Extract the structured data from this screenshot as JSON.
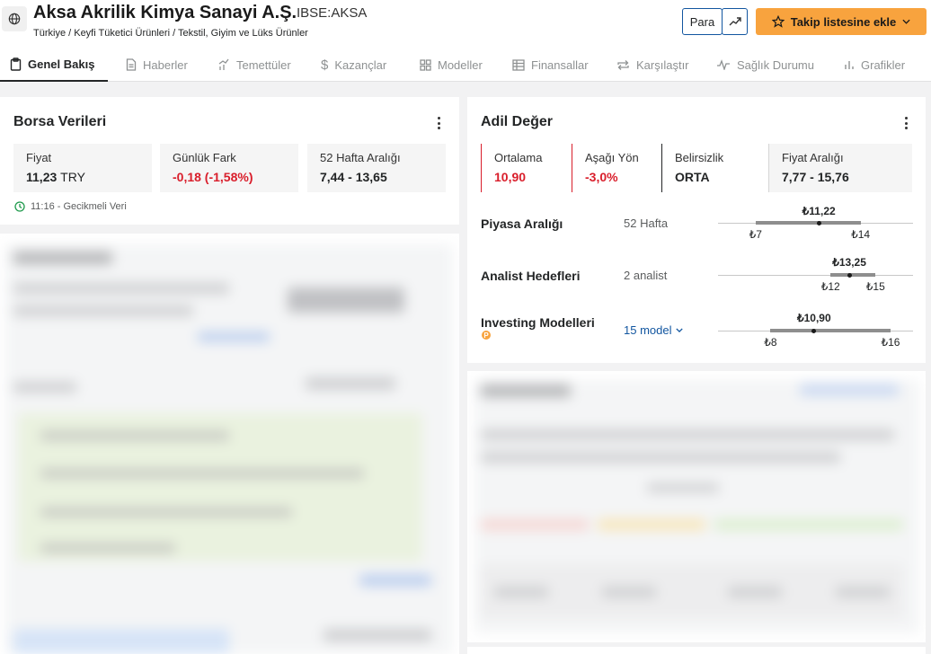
{
  "header": {
    "company": "Aksa Akrilik Kimya Sanayi A.Ş.",
    "ticker": "IBSE:AKSA",
    "breadcrumb": "Türkiye / Keyfi Tüketici Ürünleri / Tekstil, Giyim ve Lüks Ürünler",
    "currency_button": "Para",
    "follow_button": "Takip listesine ekle"
  },
  "tabs": [
    {
      "label": "Genel Bakış",
      "icon": "clipboard-icon",
      "active": true
    },
    {
      "label": "Haberler",
      "icon": "document-icon"
    },
    {
      "label": "Temettüler",
      "icon": "dividend-chart-icon"
    },
    {
      "label": "Kazançlar",
      "icon": "dollar-icon"
    },
    {
      "label": "Modeller",
      "icon": "grid-icon"
    },
    {
      "label": "Finansallar",
      "icon": "spreadsheet-icon"
    },
    {
      "label": "Karşılaştır",
      "icon": "compare-arrows-icon"
    },
    {
      "label": "Sağlık Durumu",
      "icon": "pulse-icon"
    },
    {
      "label": "Grafikler",
      "icon": "bar-chart-icon"
    }
  ],
  "market_data": {
    "title": "Borsa Verileri",
    "price_label": "Fiyat",
    "price_value": "11,23",
    "price_unit": "TRY",
    "change_label": "Günlük Fark",
    "change_value": "-0,18 (-1,58%)",
    "range_label": "52 Hafta Aralığı",
    "range_value": "7,44 - 13,65",
    "delay_note": "11:16 - Gecikmeli Veri"
  },
  "fair_value": {
    "title": "Adil Değer",
    "average_label": "Ortalama",
    "average_value": "10,90",
    "direction_label": "Aşağı Yön",
    "direction_value": "-3,0%",
    "uncertainty_label": "Belirsizlik",
    "uncertainty_value": "ORTA",
    "price_range_label": "Fiyat Aralığı",
    "price_range_value": "7,77 - 15,76",
    "rows": [
      {
        "label": "Piyasa Aralığı",
        "sub": "52 Hafta",
        "current": "₺11,22",
        "low": "₺7",
        "high": "₺14",
        "low_num": 7,
        "high_num": 14,
        "current_num": 11.22,
        "scale_min": 4.5,
        "scale_max": 17.5
      },
      {
        "label": "Analist Hedefleri",
        "sub": "2 analist",
        "current": "₺13,25",
        "low": "₺12",
        "high": "₺15",
        "low_num": 12,
        "high_num": 15,
        "current_num": 13.25,
        "scale_min": 4.5,
        "scale_max": 17.5
      },
      {
        "label": "Investing Modelleri",
        "sub": "15 model",
        "current": "₺10,90",
        "low": "₺8",
        "high": "₺16",
        "low_num": 8,
        "high_num": 16,
        "current_num": 10.9,
        "scale_min": 4.5,
        "scale_max": 17.5
      }
    ]
  },
  "colors": {
    "accent_orange": "#f8a33e",
    "negative_red": "#d91e2b",
    "link_blue": "#1256a0"
  }
}
